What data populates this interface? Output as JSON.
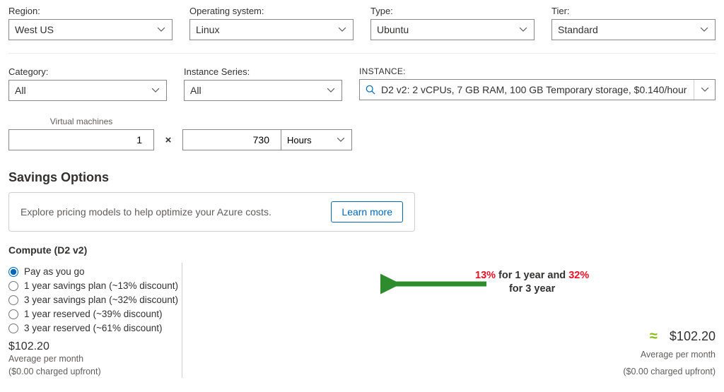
{
  "topFilters": {
    "region": {
      "label": "Region:",
      "value": "West US"
    },
    "os": {
      "label": "Operating system:",
      "value": "Linux"
    },
    "type": {
      "label": "Type:",
      "value": "Ubuntu"
    },
    "tier": {
      "label": "Tier:",
      "value": "Standard"
    }
  },
  "midFilters": {
    "category": {
      "label": "Category:",
      "value": "All"
    },
    "series": {
      "label": "Instance Series:",
      "value": "All"
    },
    "instance": {
      "label": "INSTANCE:",
      "value": "D2 v2: 2 vCPUs, 7 GB RAM, 100 GB Temporary storage, $0.140/hour"
    }
  },
  "vm": {
    "label": "Virtual machines",
    "count": "1",
    "times": "×",
    "hours": "730",
    "unit": "Hours"
  },
  "savings": {
    "heading": "Savings Options",
    "bannerText": "Explore pricing models to help optimize your Azure costs.",
    "learnMore": "Learn more"
  },
  "compute": {
    "title": "Compute (D2 v2)",
    "options": [
      "Pay as you go",
      "1 year savings plan (~13% discount)",
      "3 year savings plan (~32% discount)",
      "1 year reserved (~39% discount)",
      "3 year reserved (~61% discount)"
    ],
    "leftTotal": {
      "amount": "$102.20",
      "line1": "Average per month",
      "line2": "($0.00 charged upfront)"
    },
    "rightTotal": {
      "eq": "≈",
      "amount": "$102.20",
      "line1": "Average per month",
      "line2": "($0.00 charged upfront)"
    }
  },
  "annotation": {
    "p1": "13%",
    "p2": " for 1 year and ",
    "p3": "32%",
    "p4": "for 3 year"
  }
}
